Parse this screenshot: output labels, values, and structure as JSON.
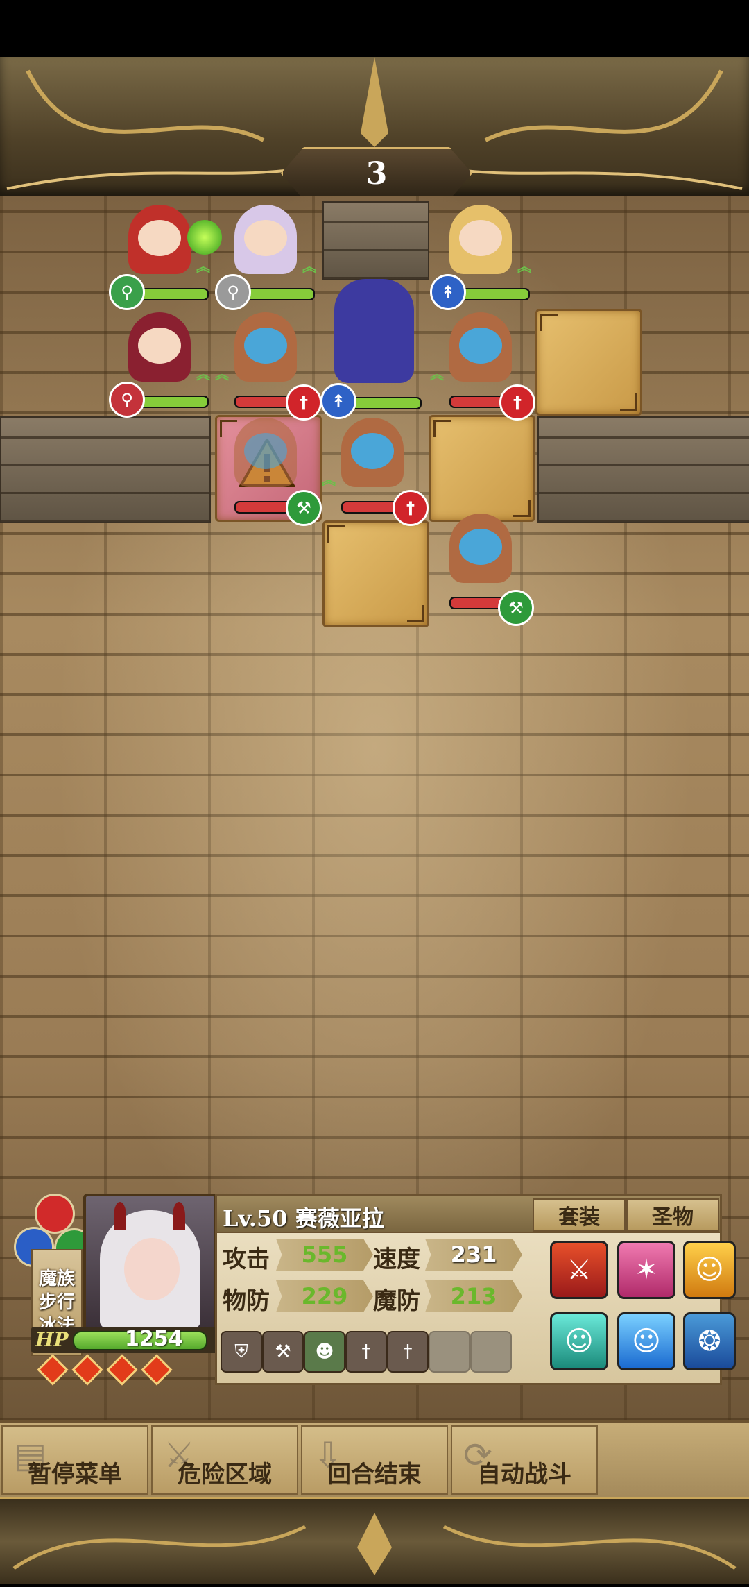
{
  "turn": {
    "number": "3"
  },
  "status": {
    "race_lines": [
      "魔族",
      "步行",
      "冰法"
    ],
    "level_name": "Lv.50 赛薇亚拉",
    "tabs": [
      "套装",
      "圣物"
    ],
    "hp_label": "HP",
    "hp_value": "1254",
    "stats": [
      {
        "label": "攻击",
        "value": "555"
      },
      {
        "label": "速度",
        "value": "231"
      },
      {
        "label": "物防",
        "value": "229"
      },
      {
        "label": "魔防",
        "value": "213"
      }
    ]
  },
  "commands": [
    "暂停菜单",
    "危险区域",
    "回合结束",
    "自动战斗"
  ],
  "units": [
    {
      "weapon": "staff-icon",
      "side": "ally",
      "color": "#3aa04a"
    },
    {
      "weapon": "staff-icon",
      "side": "ally",
      "color": "#9a9a9a"
    },
    {
      "weapon": "lance-icon",
      "side": "ally",
      "color": "#2e62c6"
    },
    {
      "weapon": "staff-icon",
      "side": "ally",
      "color": "#c4323a"
    },
    {
      "weapon": "sword-icon",
      "side": "enemy",
      "color": "#d1242a"
    },
    {
      "weapon": "lance-icon",
      "side": "ally",
      "color": "#2e62c6"
    },
    {
      "weapon": "sword-icon",
      "side": "enemy",
      "color": "#d1242a"
    },
    {
      "weapon": "axe-icon",
      "side": "enemy",
      "color": "#2e9a3a"
    },
    {
      "weapon": "sword-icon",
      "side": "enemy",
      "color": "#d1242a"
    },
    {
      "weapon": "axe-icon",
      "side": "enemy",
      "color": "#2e9a3a"
    }
  ]
}
